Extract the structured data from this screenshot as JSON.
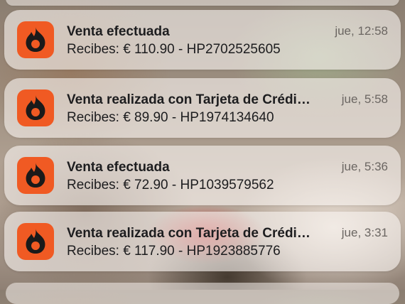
{
  "notifications": [
    {
      "app_icon": "fire-icon",
      "title": "Venta efectuada",
      "body": "Recibes: € 110.90 - HP2702525605",
      "time": "jue, 12:58"
    },
    {
      "app_icon": "fire-icon",
      "title": "Venta realizada con Tarjeta de Crédi…",
      "body": "Recibes: € 89.90 - HP1974134640",
      "time": "jue, 5:58"
    },
    {
      "app_icon": "fire-icon",
      "title": "Venta efectuada",
      "body": "Recibes: € 72.90 - HP1039579562",
      "time": "jue, 5:36"
    },
    {
      "app_icon": "fire-icon",
      "title": "Venta realizada con Tarjeta de Crédi…",
      "body": "Recibes: € 117.90 - HP1923885776",
      "time": "jue, 3:31"
    }
  ],
  "colors": {
    "app_icon_bg": "#f05a23",
    "icon_fg": "#1a1a1a"
  }
}
